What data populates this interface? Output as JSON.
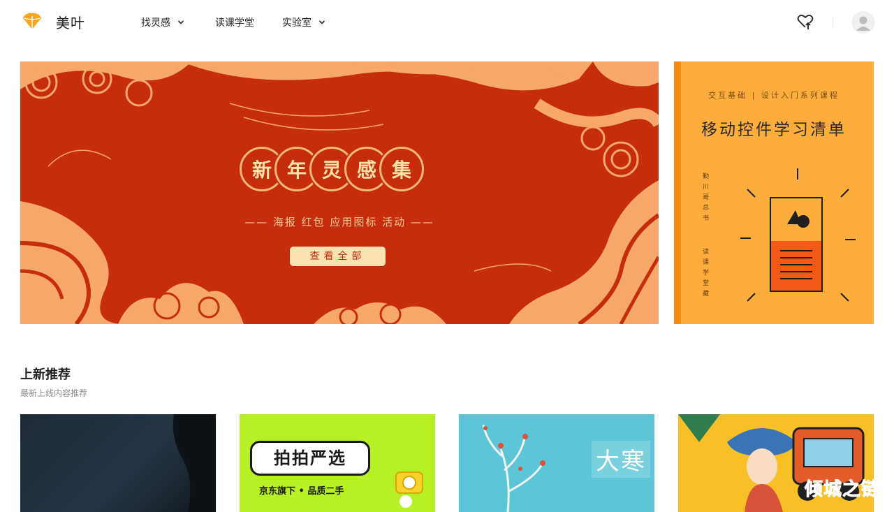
{
  "header": {
    "brand": "美叶",
    "nav": [
      {
        "label": "找灵感",
        "has_dropdown": true
      },
      {
        "label": "读课学堂",
        "has_dropdown": false
      },
      {
        "label": "实验室",
        "has_dropdown": true
      }
    ],
    "icons": {
      "logo": "leaf-logo-icon",
      "upload": "heart-upload-icon",
      "avatar": "user-avatar-icon"
    }
  },
  "banner_main": {
    "characters": [
      "新",
      "年",
      "灵",
      "感",
      "集"
    ],
    "subtitle": "—— 海报  红包  应用图标  活动 ——",
    "button": "查看全部",
    "colors": {
      "background": "#c62d0d",
      "accent": "#f4b97a"
    }
  },
  "banner_side": {
    "top_text": "交互基础 | 设计入门系列课程",
    "title": "移动控件学习清单",
    "vertical_text_1": "勤川哥总书",
    "vertical_text_2": "读课学堂藏",
    "colors": {
      "background": "#fdad3c",
      "stripe": "#f58a10"
    }
  },
  "section": {
    "title": "上新推荐",
    "subtitle": "最新上线内容推荐"
  },
  "cards": [
    {
      "text": ""
    },
    {
      "logo_text": "拍拍严选",
      "subtitle": "京东旗下 • 品质二手"
    },
    {
      "text": "大寒"
    },
    {
      "text": ""
    }
  ],
  "watermark": "倾城之链"
}
